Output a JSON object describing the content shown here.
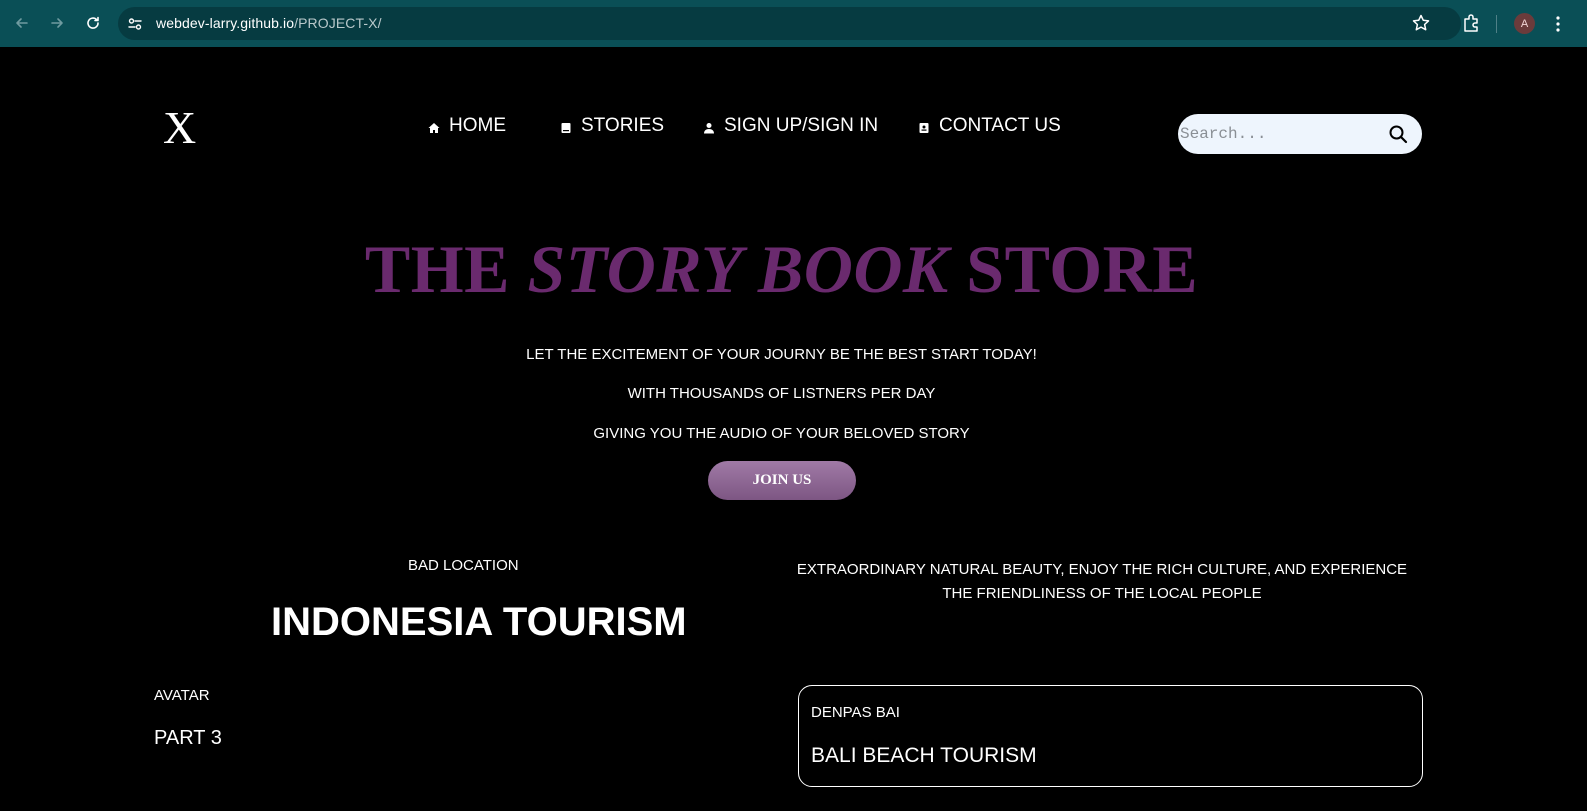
{
  "browser": {
    "url_host": "webdev-larry.github.io",
    "url_path": "/PROJECT-X/",
    "profile_initial": "A"
  },
  "site": {
    "logo": "X",
    "nav": [
      {
        "label": "HOME",
        "icon": "home-icon"
      },
      {
        "label": "STORIES",
        "icon": "book-icon"
      },
      {
        "label": "SIGN UP/SIGN IN",
        "icon": "user-icon"
      },
      {
        "label": "CONTACT US",
        "icon": "contact-icon"
      }
    ],
    "search_placeholder": "Search...",
    "colors": {
      "title_purple": "#6a2a6e",
      "button_purple": "#8e6795",
      "chrome_teal": "#0a4f56"
    }
  },
  "hero": {
    "title_part1": "THE ",
    "title_italic": "STORY BOOK",
    "title_part2": " STORE",
    "lines": [
      "LET THE EXCITEMENT OF YOUR JOURNY BE THE BEST START TODAY!",
      "WITH THOUSANDS OF LISTNERS PER DAY",
      "GIVING YOU THE AUDIO OF YOUR BELOVED STORY"
    ],
    "join_label": "JOIN US"
  },
  "left_section": {
    "kicker": "BAD LOCATION",
    "title": "INDONESIA TOURISM",
    "avatar_label": "AVATAR",
    "part_label": "PART 3"
  },
  "right_section": {
    "description": "EXTRAORDINARY NATURAL BEAUTY, ENJOY THE RICH CULTURE, AND EXPERIENCE THE FRIENDLINESS OF THE LOCAL PEOPLE",
    "card": {
      "subtitle": "DENPAS BAI",
      "title": "BALI BEACH TOURISM"
    }
  }
}
